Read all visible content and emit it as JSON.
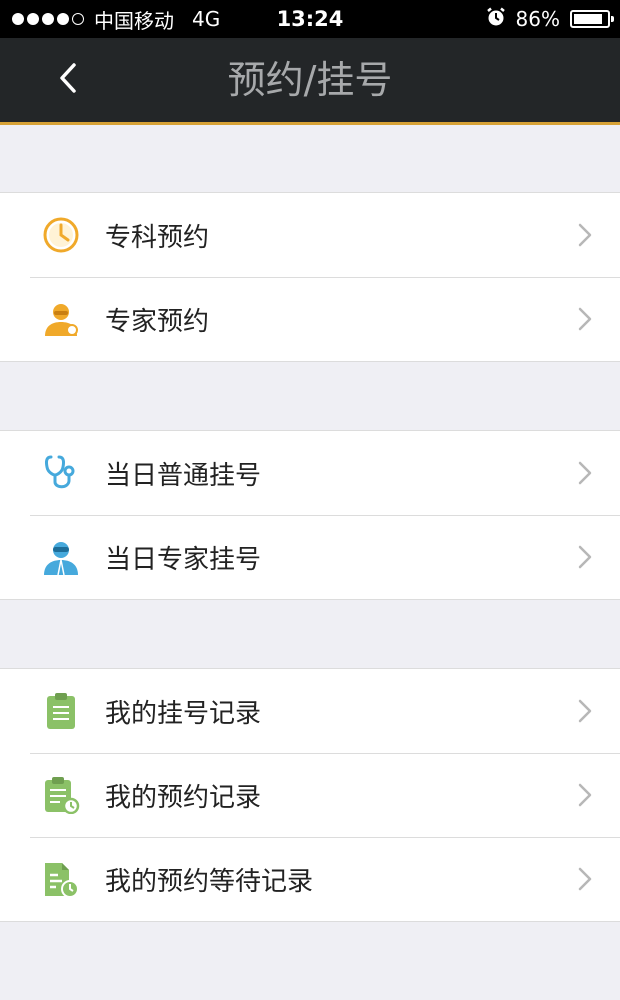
{
  "status_bar": {
    "carrier": "中国移动",
    "network": "4G",
    "time": "13:24",
    "battery": "86%",
    "battery_level": 0.86
  },
  "nav": {
    "title": "预约/挂号",
    "back_icon": "chevron-left-icon"
  },
  "groups": [
    {
      "items": [
        {
          "label": "专科预约",
          "icon": "clock-icon",
          "color": "#f0a92a"
        },
        {
          "label": "专家预约",
          "icon": "doctor-icon",
          "color": "#f0a92a"
        }
      ]
    },
    {
      "items": [
        {
          "label": "当日普通挂号",
          "icon": "stethoscope-icon",
          "color": "#46a9dc"
        },
        {
          "label": "当日专家挂号",
          "icon": "doctor-icon",
          "color": "#46a9dc"
        }
      ]
    },
    {
      "items": [
        {
          "label": "我的挂号记录",
          "icon": "clipboard-icon",
          "color": "#8bc167"
        },
        {
          "label": "我的预约记录",
          "icon": "clipboard-clock-icon",
          "color": "#8bc167"
        },
        {
          "label": "我的预约等待记录",
          "icon": "document-clock-icon",
          "color": "#8bc167"
        }
      ]
    }
  ]
}
